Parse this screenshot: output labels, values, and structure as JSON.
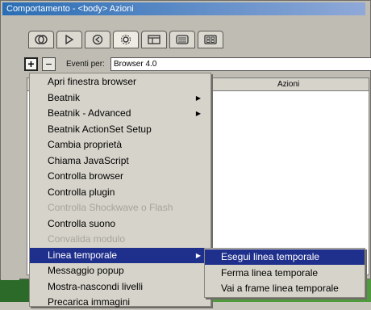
{
  "window": {
    "title": "Comportamento - <body> Azioni"
  },
  "tabs": [
    "layers-icon",
    "forward-icon",
    "back-icon",
    "gear-icon",
    "window-icon",
    "list-icon",
    "grid-icon"
  ],
  "toolbar": {
    "add_label": "+",
    "remove_label": "−",
    "events_label": "Eventi per:",
    "events_value": "Browser 4.0"
  },
  "list": {
    "col_actions": "Azioni"
  },
  "menu": {
    "items": [
      {
        "label": "Apri finestra browser",
        "state": "enabled",
        "submenu": false
      },
      {
        "label": "Beatnik",
        "state": "enabled",
        "submenu": true
      },
      {
        "label": "Beatnik - Advanced",
        "state": "enabled",
        "submenu": true
      },
      {
        "label": "Beatnik ActionSet Setup",
        "state": "enabled",
        "submenu": false
      },
      {
        "label": "Cambia proprietà",
        "state": "enabled",
        "submenu": false
      },
      {
        "label": "Chiama JavaScript",
        "state": "enabled",
        "submenu": false
      },
      {
        "label": "Controlla browser",
        "state": "enabled",
        "submenu": false
      },
      {
        "label": "Controlla plugin",
        "state": "enabled",
        "submenu": false
      },
      {
        "label": "Controlla Shockwave o Flash",
        "state": "disabled",
        "submenu": false
      },
      {
        "label": "Controlla suono",
        "state": "enabled",
        "submenu": false
      },
      {
        "label": "Convalida modulo",
        "state": "disabled",
        "submenu": false
      },
      {
        "label": "Linea temporale",
        "state": "selected",
        "submenu": true
      },
      {
        "label": "Messaggio popup",
        "state": "enabled",
        "submenu": false
      },
      {
        "label": "Mostra-nascondi livelli",
        "state": "enabled",
        "submenu": false
      },
      {
        "label": "Precarica immagini",
        "state": "enabled",
        "submenu": false
      }
    ]
  },
  "submenu": {
    "items": [
      {
        "label": "Esegui linea temporale",
        "state": "selected"
      },
      {
        "label": "Ferma linea temporale",
        "state": "enabled"
      },
      {
        "label": "Vai a frame linea temporale",
        "state": "enabled"
      }
    ]
  },
  "colors": {
    "selection": "#1f2f8c",
    "titlebar": "#2a6db4",
    "menu_bg": "#d6d3ca"
  }
}
